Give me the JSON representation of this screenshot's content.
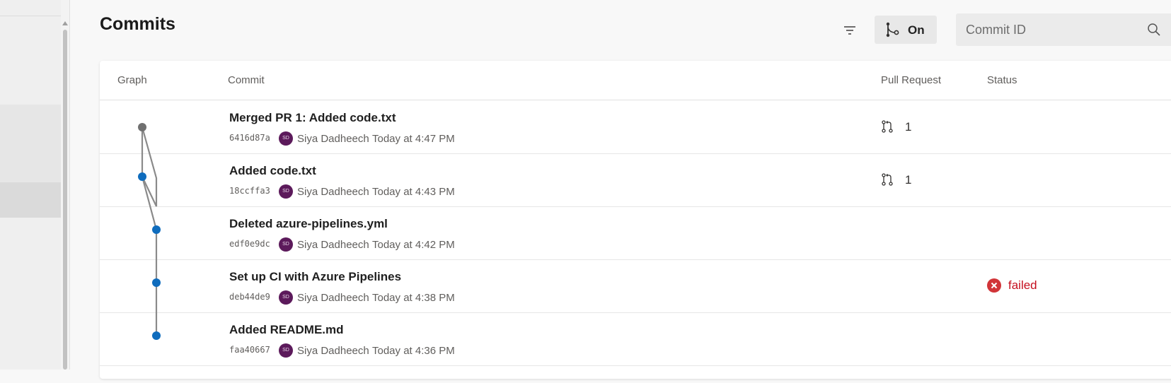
{
  "page": {
    "title": "Commits"
  },
  "toolbar": {
    "filter_icon": "filter-icon",
    "graph_toggle_icon": "branch-graph-icon",
    "graph_toggle_label": "On",
    "search_placeholder": "Commit ID",
    "search_value": "",
    "search_icon": "search-icon"
  },
  "table": {
    "columns": {
      "graph": "Graph",
      "commit": "Commit",
      "pull_request": "Pull Request",
      "status": "Status"
    },
    "rows": [
      {
        "title": "Merged PR 1: Added code.txt",
        "hash": "6416d87a",
        "avatar_initials": "SD",
        "author": "Siya Dadheech",
        "time": "Today at 4:47 PM",
        "pr": "1",
        "status": ""
      },
      {
        "title": "Added code.txt",
        "hash": "18ccffa3",
        "avatar_initials": "SD",
        "author": "Siya Dadheech",
        "time": "Today at 4:43 PM",
        "pr": "1",
        "status": ""
      },
      {
        "title": "Deleted azure-pipelines.yml",
        "hash": "edf0e9dc",
        "avatar_initials": "SD",
        "author": "Siya Dadheech",
        "time": "Today at 4:42 PM",
        "pr": "",
        "status": ""
      },
      {
        "title": "Set up CI with Azure Pipelines",
        "hash": "deb44de9",
        "avatar_initials": "SD",
        "author": "Siya Dadheech",
        "time": "Today at 4:38 PM",
        "pr": "",
        "status": "failed"
      },
      {
        "title": "Added README.md",
        "hash": "faa40667",
        "avatar_initials": "SD",
        "author": "Siya Dadheech",
        "time": "Today at 4:36 PM",
        "pr": "",
        "status": ""
      }
    ]
  },
  "colors": {
    "node_merge": "#707070",
    "node_commit": "#0f6cbd",
    "status_failed": "#d13438",
    "avatar_bg": "#5c1a5b"
  }
}
